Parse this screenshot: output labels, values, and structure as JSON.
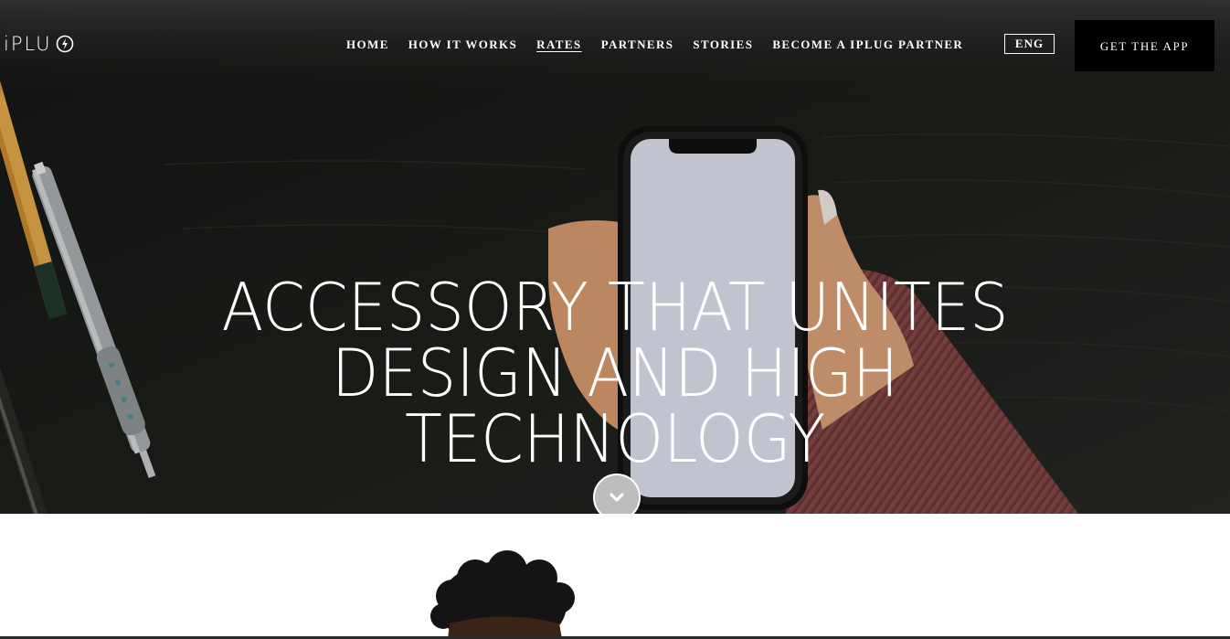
{
  "brand": {
    "name": "iPLU",
    "mark_icon": "lightning-bolt-icon"
  },
  "nav": {
    "items": [
      {
        "label": "HOME",
        "active": false
      },
      {
        "label": "HOW IT WORKS",
        "active": false
      },
      {
        "label": "RATES",
        "active": true
      },
      {
        "label": "PARTNERS",
        "active": false
      },
      {
        "label": "STORIES",
        "active": false
      },
      {
        "label": "BECOME A IPLUG PARTNER",
        "active": false
      }
    ]
  },
  "language": {
    "label": "ENG"
  },
  "cta": {
    "label": "GET THE APP"
  },
  "hero": {
    "headline_lines": [
      "ACCESSORY THAT UNITES",
      "DESIGN AND HIGH",
      "TECHNOLOGY"
    ],
    "scroll_icon": "chevron-down-icon"
  },
  "colors": {
    "hero_bg": "#1a1b18",
    "cta_bg": "#000000",
    "scroll_button": "#bdbdbd",
    "sweater": "#8a4a4a"
  }
}
